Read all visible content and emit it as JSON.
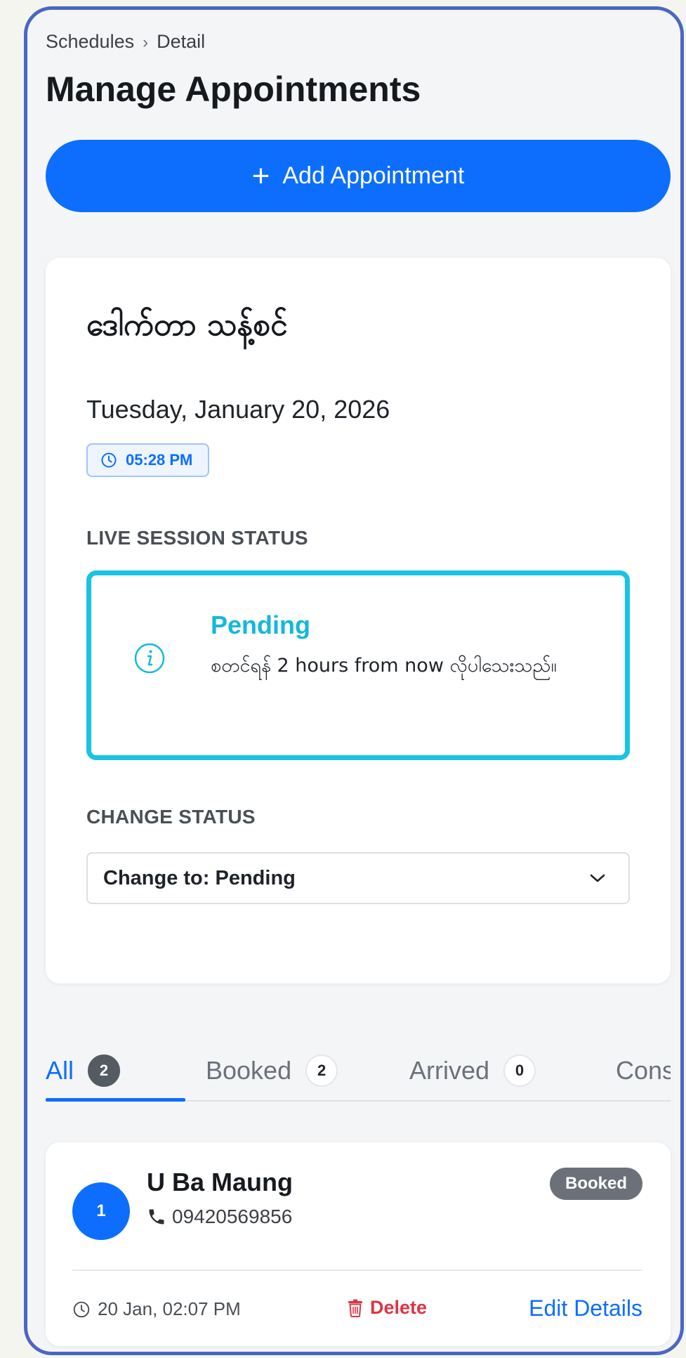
{
  "header": {
    "breadcrumb": [
      "Schedules",
      "Detail"
    ],
    "breadcrumb_separator": "›",
    "title": "Manage Appointments"
  },
  "actions": {
    "add_icon": "plus-icon",
    "add_label": "Add Appointment"
  },
  "session": {
    "doctor_name": "ဒေါက်တာ သန့်စင်",
    "date": "Tuesday, January 20, 2026",
    "time": "05:28 PM",
    "time_icon": "clock-icon",
    "live_status_label": "LIVE SESSION STATUS",
    "status": {
      "icon": "info-icon",
      "title": "Pending",
      "message": "စတင်ရန် 2 hours from now လိုပါသေးသည်။"
    },
    "change_status_label": "CHANGE STATUS",
    "change_status_value": "Change to: Pending",
    "select_icon": "chevron-down-icon"
  },
  "tabs": [
    {
      "label": "All",
      "count": "2",
      "active": true
    },
    {
      "label": "Booked",
      "count": "2",
      "active": false
    },
    {
      "label": "Arrived",
      "count": "0",
      "active": false
    },
    {
      "label": "Cons",
      "count": "",
      "active": false
    }
  ],
  "appointments": [
    {
      "queue": "1",
      "name": "U Ba Maung",
      "phone_icon": "phone-icon",
      "phone": "09420569856",
      "status": "Booked",
      "time_icon": "clock-icon",
      "time": "20 Jan, 02:07 PM",
      "delete_icon": "trash-icon",
      "delete_label": "Delete",
      "edit_label": "Edit Details"
    }
  ],
  "colors": {
    "primary": "#0d6efd",
    "info": "#19c3e6",
    "danger": "#dc3545",
    "frame_border": "#4a67c4",
    "badge_gray": "#6c7179"
  }
}
